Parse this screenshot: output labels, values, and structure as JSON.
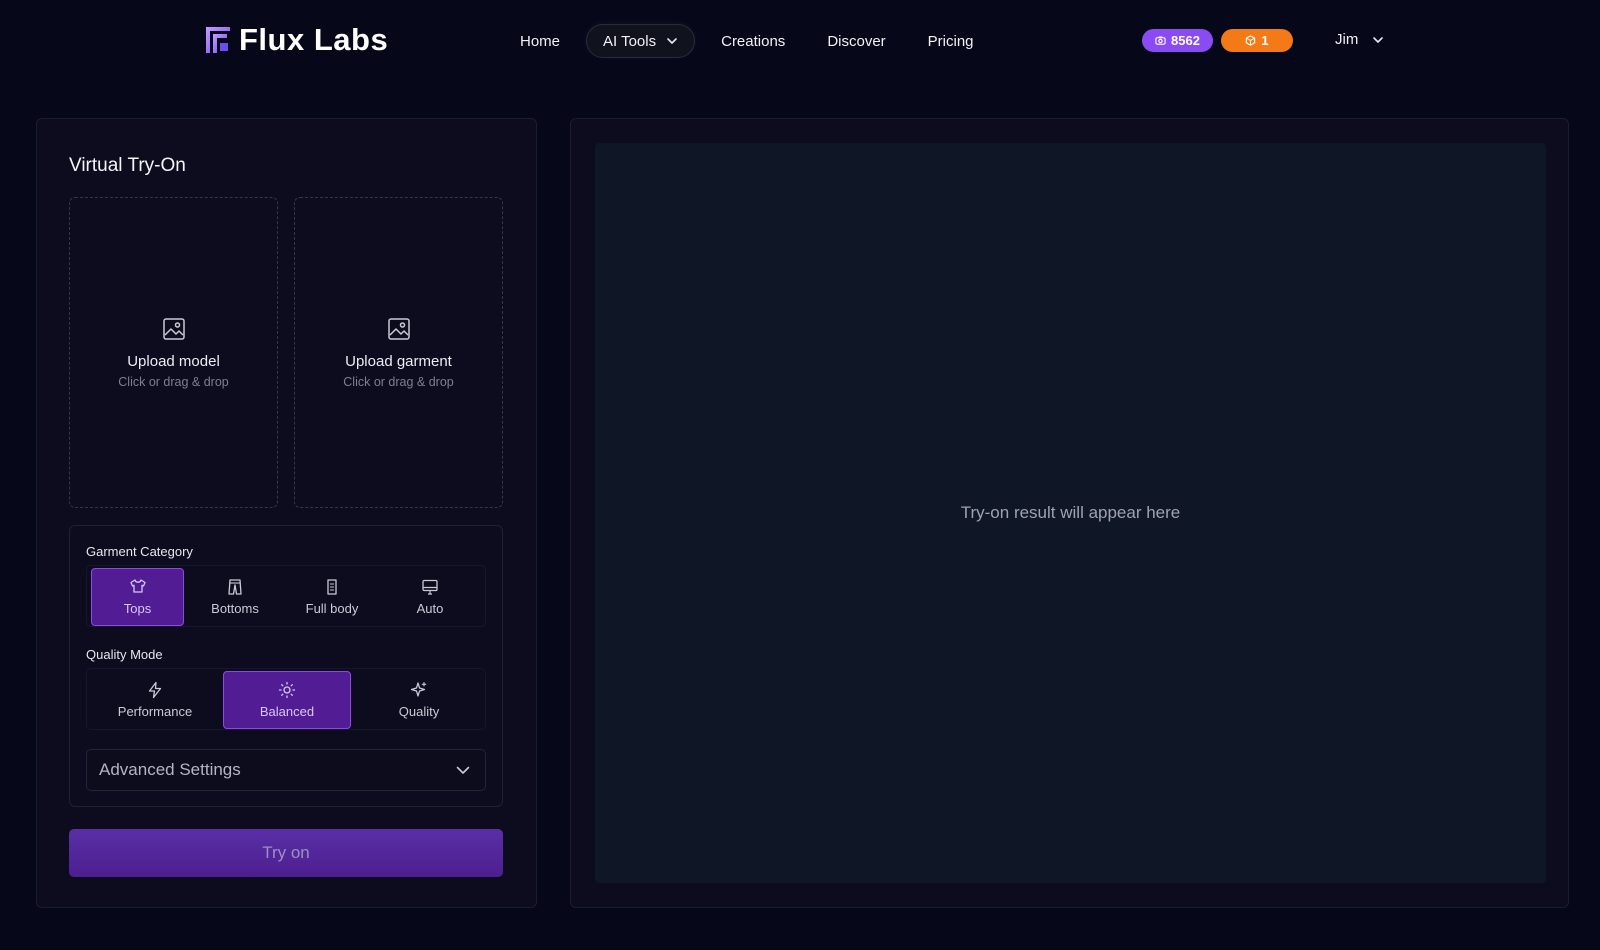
{
  "brand": {
    "name": "Flux Labs",
    "logo_icon": "flux-logo-icon",
    "accent": "#8a4bf2"
  },
  "nav": {
    "items": [
      {
        "label": "Home"
      },
      {
        "label": "AI Tools",
        "has_dropdown": true
      },
      {
        "label": "Creations"
      },
      {
        "label": "Discover"
      },
      {
        "label": "Pricing"
      }
    ]
  },
  "badges": {
    "credits": {
      "value": "8562",
      "color": "#8a4bf2",
      "icon": "camera-icon"
    },
    "gems": {
      "value": "1",
      "color": "#f47a18",
      "icon": "gem-icon"
    }
  },
  "user": {
    "name": "Jim"
  },
  "left_panel": {
    "title": "Virtual Try-On",
    "upload_model": {
      "title": "Upload model",
      "subtitle": "Click or drag & drop"
    },
    "upload_garment": {
      "title": "Upload garment",
      "subtitle": "Click or drag & drop"
    },
    "garment_category": {
      "label": "Garment Category",
      "options": [
        {
          "label": "Tops",
          "icon": "shirt-icon",
          "selected": true
        },
        {
          "label": "Bottoms",
          "icon": "pants-icon",
          "selected": false
        },
        {
          "label": "Full body",
          "icon": "dress-icon",
          "selected": false
        },
        {
          "label": "Auto",
          "icon": "monitor-icon",
          "selected": false
        }
      ]
    },
    "quality_mode": {
      "label": "Quality Mode",
      "options": [
        {
          "label": "Performance",
          "icon": "bolt-icon",
          "selected": false
        },
        {
          "label": "Balanced",
          "icon": "sun-icon",
          "selected": true
        },
        {
          "label": "Quality",
          "icon": "sparkles-icon",
          "selected": false
        }
      ]
    },
    "advanced_settings": {
      "label": "Advanced Settings"
    },
    "try_button": {
      "label": "Try on"
    }
  },
  "right_panel": {
    "placeholder": "Try-on result will appear here"
  },
  "colors": {
    "active_segment": "#521c94",
    "active_border": "#8b49e6",
    "button": "#4c1f90",
    "background": "#07071a"
  }
}
